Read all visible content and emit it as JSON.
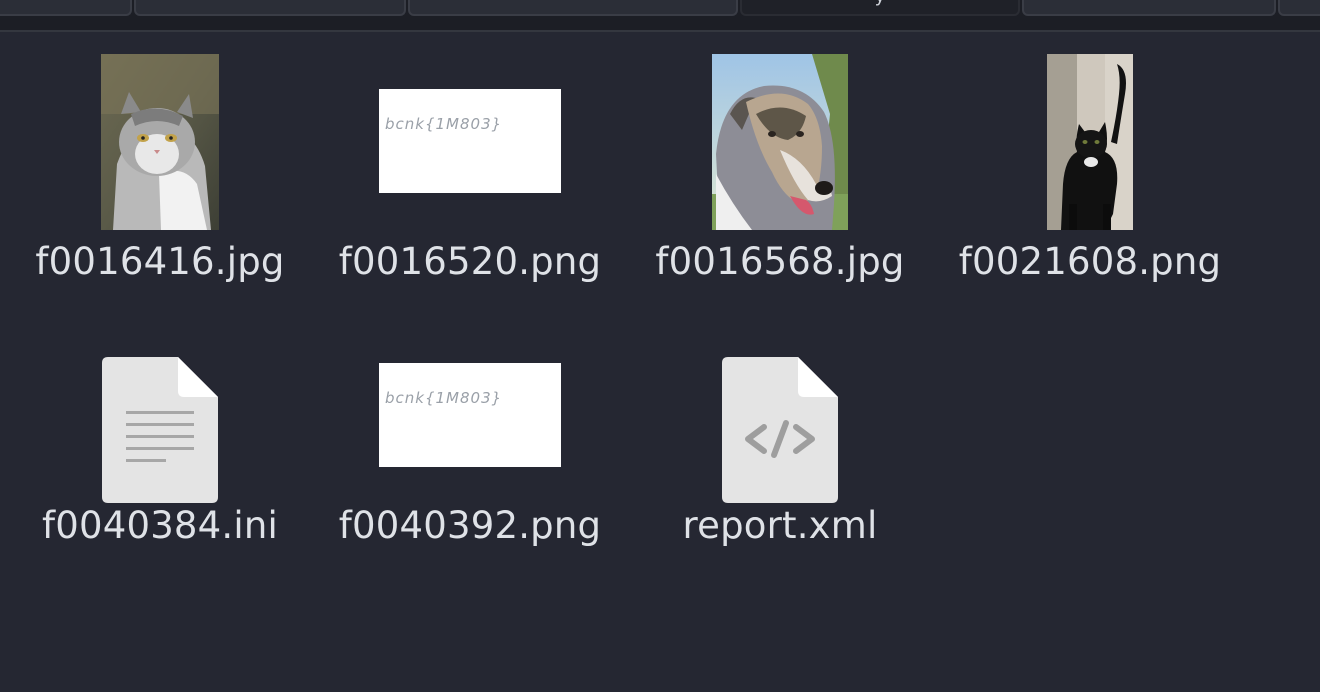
{
  "tabs": [
    {
      "label": ""
    },
    {
      "label": ""
    },
    {
      "label": ""
    },
    {
      "label": "y"
    },
    {
      "label": ""
    }
  ],
  "files": [
    {
      "name": "f0016416.jpg",
      "icon": "cat-photo-thumbnail"
    },
    {
      "name": "f0016520.png",
      "icon": "handwritten-flag-thumbnail",
      "thumb_text": "bcnk{1M803}"
    },
    {
      "name": "f0016568.jpg",
      "icon": "dog-photo-thumbnail"
    },
    {
      "name": "f0021608.png",
      "icon": "black-cat-photo-thumbnail"
    },
    {
      "name": "f0040384.ini",
      "icon": "text-document-icon"
    },
    {
      "name": "f0040392.png",
      "icon": "handwritten-flag-thumbnail",
      "thumb_text": "bcnk{1M803}"
    },
    {
      "name": "report.xml",
      "icon": "code-document-icon"
    }
  ],
  "colors": {
    "background": "#252732",
    "caption": "#dfe2e7",
    "doc_icon": "#e4e4e4"
  }
}
